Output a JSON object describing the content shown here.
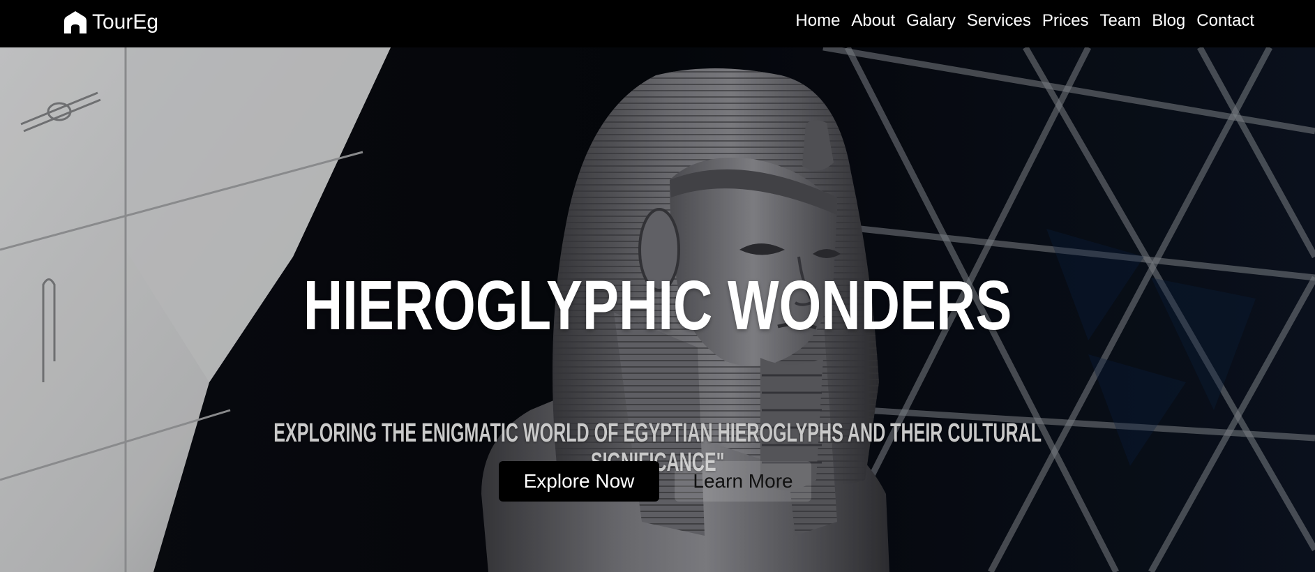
{
  "brand": {
    "name": "TourEg",
    "icon": "house-icon"
  },
  "nav": {
    "items": [
      {
        "label": "Home"
      },
      {
        "label": "About"
      },
      {
        "label": "Galary"
      },
      {
        "label": "Services"
      },
      {
        "label": "Prices"
      },
      {
        "label": "Team"
      },
      {
        "label": "Blog"
      },
      {
        "label": "Contact"
      }
    ]
  },
  "hero": {
    "title": "HIEROGLYPHIC WONDERS",
    "subtitle": "EXPLORING THE ENIGMATIC WORLD OF EGYPTIAN HIEROGLYPHS AND THEIR CULTURAL SIGNIFICANCE\"",
    "primary_button": "Explore Now",
    "secondary_button": "Learn More",
    "background_image": "pharaoh-statue-photo"
  },
  "colors": {
    "navbar_bg": "#000000",
    "text_primary": "#ffffff",
    "subtitle_text": "#c9c9c9",
    "button_primary_bg": "#000000"
  }
}
